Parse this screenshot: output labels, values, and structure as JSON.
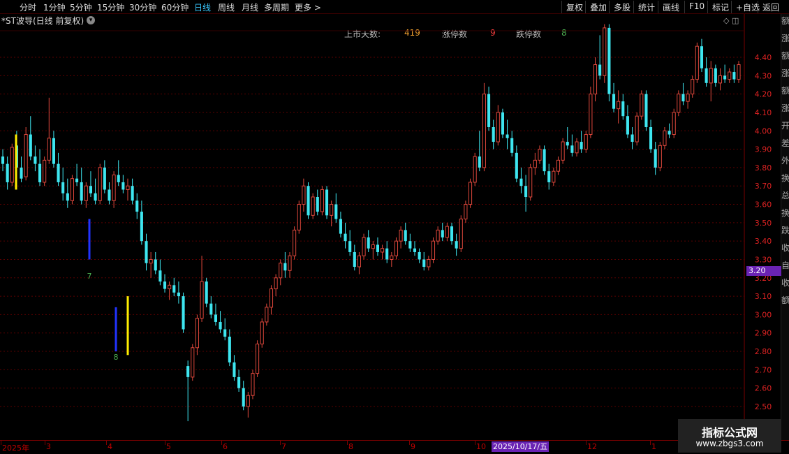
{
  "toolbar": {
    "left_items": [
      "分时",
      "1分钟",
      "5分钟",
      "15分钟",
      "30分钟",
      "60分钟",
      "日线",
      "周线",
      "月线",
      "多周期",
      "更多 >"
    ],
    "active_index": 6,
    "right_items": [
      "复权",
      "叠加",
      "多股",
      "统计",
      "画线",
      "F10",
      "标记",
      "+自选",
      "返回"
    ]
  },
  "stock": {
    "title": "*ST波导(日线 前复权)",
    "dropdown_icon": "chevron-down-icon",
    "corner_icons": "◇ ◫"
  },
  "stats": {
    "listed_days_label": "上市天数:",
    "listed_days_value": "419",
    "limit_up_label": "涨停数",
    "limit_up_value": "9",
    "limit_down_label": "跌停数",
    "limit_down_value": "8"
  },
  "price_axis": {
    "ticks": [
      "4.40",
      "4.30",
      "4.20",
      "4.10",
      "4.00",
      "3.90",
      "3.80",
      "3.70",
      "3.60",
      "3.50",
      "3.40",
      "3.30",
      "3.20",
      "3.10",
      "3.00",
      "2.90",
      "2.80",
      "2.70",
      "2.60",
      "2.50"
    ],
    "current_price": "3.20"
  },
  "markers": [
    {
      "label": "7",
      "color": "#4caf50"
    },
    {
      "label": "8",
      "color": "#4caf50"
    }
  ],
  "date_axis": {
    "labels": [
      "2025年",
      "3",
      "4",
      "5",
      "6",
      "7",
      "8",
      "9",
      "10",
      "12",
      "1"
    ],
    "cursor_date": "2025/10/17/五"
  },
  "right_strip_text": "额涨额涨额涨开差外换总换跌收自收额",
  "watermark": {
    "title": "指标公式网",
    "url": "www.zbgs3.com"
  },
  "colors": {
    "up": "#e0483c",
    "down": "#3ee6f0",
    "grid": "#5a0000",
    "accent_purple": "#6a23b4"
  },
  "chart_data": {
    "type": "candlestick",
    "title": "*ST波导(日线 前复权)",
    "ylim": [
      2.42,
      4.58
    ],
    "x_start_label": "2025年",
    "ohlc": [
      [
        3.86,
        3.9,
        3.78,
        3.82
      ],
      [
        3.82,
        3.86,
        3.68,
        3.72
      ],
      [
        3.72,
        3.93,
        3.7,
        3.91
      ],
      [
        3.92,
        4.0,
        3.78,
        3.8
      ],
      [
        3.8,
        3.86,
        3.72,
        3.74
      ],
      [
        3.75,
        4.02,
        3.73,
        3.98
      ],
      [
        3.98,
        4.08,
        3.84,
        3.86
      ],
      [
        3.86,
        3.92,
        3.78,
        3.82
      ],
      [
        3.82,
        3.9,
        3.7,
        3.72
      ],
      [
        3.72,
        3.86,
        3.7,
        3.84
      ],
      [
        3.84,
        4.18,
        3.82,
        3.96
      ],
      [
        3.96,
        4.0,
        3.8,
        3.82
      ],
      [
        3.82,
        3.88,
        3.7,
        3.72
      ],
      [
        3.72,
        3.8,
        3.62,
        3.66
      ],
      [
        3.66,
        3.74,
        3.58,
        3.62
      ],
      [
        3.62,
        3.76,
        3.6,
        3.74
      ],
      [
        3.74,
        3.82,
        3.7,
        3.72
      ],
      [
        3.72,
        3.8,
        3.6,
        3.62
      ],
      [
        3.62,
        3.72,
        3.58,
        3.7
      ],
      [
        3.7,
        3.78,
        3.64,
        3.66
      ],
      [
        3.66,
        3.74,
        3.6,
        3.62
      ],
      [
        3.62,
        3.82,
        3.6,
        3.8
      ],
      [
        3.8,
        3.84,
        3.66,
        3.68
      ],
      [
        3.68,
        3.72,
        3.6,
        3.62
      ],
      [
        3.62,
        3.78,
        3.58,
        3.76
      ],
      [
        3.76,
        3.84,
        3.7,
        3.72
      ],
      [
        3.72,
        3.76,
        3.66,
        3.68
      ],
      [
        3.68,
        3.74,
        3.62,
        3.7
      ],
      [
        3.7,
        3.74,
        3.6,
        3.62
      ],
      [
        3.62,
        3.66,
        3.52,
        3.56
      ],
      [
        3.56,
        3.62,
        3.38,
        3.4
      ],
      [
        3.4,
        3.44,
        3.24,
        3.28
      ],
      [
        3.28,
        3.34,
        3.2,
        3.3
      ],
      [
        3.3,
        3.34,
        3.22,
        3.24
      ],
      [
        3.24,
        3.3,
        3.16,
        3.18
      ],
      [
        3.18,
        3.22,
        3.12,
        3.14
      ],
      [
        3.14,
        3.18,
        3.08,
        3.16
      ],
      [
        3.16,
        3.2,
        3.1,
        3.12
      ],
      [
        3.12,
        3.18,
        3.06,
        3.1
      ],
      [
        3.1,
        3.12,
        2.9,
        2.92
      ],
      [
        2.72,
        2.75,
        2.42,
        2.66
      ],
      [
        2.66,
        2.84,
        2.64,
        2.82
      ],
      [
        2.82,
        3.0,
        2.78,
        2.98
      ],
      [
        2.98,
        3.32,
        2.96,
        3.18
      ],
      [
        3.18,
        3.2,
        3.04,
        3.06
      ],
      [
        3.06,
        3.1,
        2.98,
        3.0
      ],
      [
        3.0,
        3.06,
        2.94,
        2.96
      ],
      [
        2.96,
        3.02,
        2.9,
        2.92
      ],
      [
        2.92,
        2.98,
        2.86,
        2.88
      ],
      [
        2.88,
        2.92,
        2.72,
        2.74
      ],
      [
        2.74,
        2.78,
        2.64,
        2.66
      ],
      [
        2.66,
        2.7,
        2.58,
        2.6
      ],
      [
        2.6,
        2.64,
        2.48,
        2.5
      ],
      [
        2.5,
        2.58,
        2.44,
        2.56
      ],
      [
        2.56,
        2.7,
        2.54,
        2.68
      ],
      [
        2.68,
        2.86,
        2.66,
        2.84
      ],
      [
        2.84,
        2.98,
        2.82,
        2.96
      ],
      [
        2.96,
        3.06,
        2.94,
        3.04
      ],
      [
        3.04,
        3.16,
        3.0,
        3.14
      ],
      [
        3.14,
        3.22,
        3.1,
        3.2
      ],
      [
        3.2,
        3.3,
        3.16,
        3.28
      ],
      [
        3.28,
        3.34,
        3.2,
        3.24
      ],
      [
        3.24,
        3.34,
        3.2,
        3.32
      ],
      [
        3.32,
        3.48,
        3.3,
        3.46
      ],
      [
        3.46,
        3.62,
        3.44,
        3.6
      ],
      [
        3.6,
        3.74,
        3.56,
        3.7
      ],
      [
        3.7,
        3.72,
        3.52,
        3.54
      ],
      [
        3.54,
        3.66,
        3.52,
        3.64
      ],
      [
        3.64,
        3.68,
        3.54,
        3.56
      ],
      [
        3.56,
        3.7,
        3.54,
        3.68
      ],
      [
        3.68,
        3.7,
        3.52,
        3.54
      ],
      [
        3.54,
        3.62,
        3.48,
        3.6
      ],
      [
        3.6,
        3.66,
        3.5,
        3.52
      ],
      [
        3.52,
        3.56,
        3.42,
        3.44
      ],
      [
        3.44,
        3.5,
        3.36,
        3.4
      ],
      [
        3.4,
        3.46,
        3.32,
        3.34
      ],
      [
        3.34,
        3.38,
        3.24,
        3.26
      ],
      [
        3.26,
        3.34,
        3.22,
        3.32
      ],
      [
        3.32,
        3.44,
        3.3,
        3.42
      ],
      [
        3.42,
        3.46,
        3.34,
        3.36
      ],
      [
        3.36,
        3.4,
        3.3,
        3.38
      ],
      [
        3.38,
        3.42,
        3.32,
        3.34
      ],
      [
        3.34,
        3.38,
        3.3,
        3.36
      ],
      [
        3.36,
        3.4,
        3.28,
        3.3
      ],
      [
        3.3,
        3.34,
        3.26,
        3.32
      ],
      [
        3.32,
        3.42,
        3.3,
        3.4
      ],
      [
        3.4,
        3.48,
        3.36,
        3.46
      ],
      [
        3.46,
        3.5,
        3.38,
        3.4
      ],
      [
        3.4,
        3.44,
        3.34,
        3.36
      ],
      [
        3.36,
        3.4,
        3.32,
        3.34
      ],
      [
        3.34,
        3.36,
        3.28,
        3.3
      ],
      [
        3.3,
        3.34,
        3.24,
        3.26
      ],
      [
        3.26,
        3.32,
        3.24,
        3.3
      ],
      [
        3.3,
        3.42,
        3.28,
        3.4
      ],
      [
        3.4,
        3.48,
        3.38,
        3.46
      ],
      [
        3.46,
        3.5,
        3.4,
        3.42
      ],
      [
        3.42,
        3.5,
        3.4,
        3.48
      ],
      [
        3.48,
        3.5,
        3.38,
        3.4
      ],
      [
        3.4,
        3.44,
        3.32,
        3.36
      ],
      [
        3.36,
        3.54,
        3.34,
        3.52
      ],
      [
        3.52,
        3.62,
        3.5,
        3.6
      ],
      [
        3.6,
        3.74,
        3.58,
        3.72
      ],
      [
        3.72,
        3.88,
        3.7,
        3.86
      ],
      [
        3.86,
        4.0,
        3.78,
        3.8
      ],
      [
        3.8,
        4.26,
        3.78,
        4.2
      ],
      [
        4.2,
        4.24,
        4.0,
        4.02
      ],
      [
        4.02,
        4.06,
        3.9,
        3.94
      ],
      [
        3.94,
        4.14,
        3.92,
        4.1
      ],
      [
        4.1,
        4.12,
        3.96,
        3.98
      ],
      [
        3.98,
        4.06,
        3.9,
        3.96
      ],
      [
        3.96,
        4.0,
        3.86,
        3.88
      ],
      [
        3.88,
        3.92,
        3.72,
        3.74
      ],
      [
        3.74,
        3.8,
        3.66,
        3.7
      ],
      [
        3.7,
        3.76,
        3.56,
        3.64
      ],
      [
        3.64,
        3.82,
        3.62,
        3.8
      ],
      [
        3.8,
        3.88,
        3.76,
        3.84
      ],
      [
        3.84,
        3.92,
        3.82,
        3.9
      ],
      [
        3.9,
        3.92,
        3.76,
        3.78
      ],
      [
        3.78,
        3.82,
        3.68,
        3.72
      ],
      [
        3.72,
        3.8,
        3.7,
        3.78
      ],
      [
        3.78,
        3.86,
        3.76,
        3.84
      ],
      [
        3.84,
        3.96,
        3.82,
        3.94
      ],
      [
        3.94,
        4.02,
        3.9,
        3.92
      ],
      [
        3.92,
        3.98,
        3.86,
        3.88
      ],
      [
        3.88,
        3.96,
        3.86,
        3.94
      ],
      [
        3.94,
        4.0,
        3.88,
        3.9
      ],
      [
        3.9,
        4.0,
        3.88,
        3.98
      ],
      [
        3.98,
        4.24,
        3.96,
        4.2
      ],
      [
        4.2,
        4.4,
        4.16,
        4.36
      ],
      [
        4.36,
        4.52,
        4.28,
        4.3
      ],
      [
        4.3,
        4.58,
        4.26,
        4.56
      ],
      [
        4.56,
        4.58,
        4.16,
        4.2
      ],
      [
        4.2,
        4.26,
        4.1,
        4.12
      ],
      [
        4.12,
        4.22,
        4.04,
        4.16
      ],
      [
        4.16,
        4.2,
        4.06,
        4.08
      ],
      [
        4.08,
        4.14,
        3.96,
        3.98
      ],
      [
        3.98,
        4.02,
        3.9,
        3.94
      ],
      [
        3.94,
        4.1,
        3.92,
        4.08
      ],
      [
        4.08,
        4.22,
        4.06,
        4.2
      ],
      [
        4.2,
        4.22,
        4.0,
        4.02
      ],
      [
        4.02,
        4.06,
        3.88,
        3.9
      ],
      [
        3.9,
        3.94,
        3.76,
        3.8
      ],
      [
        3.8,
        3.94,
        3.78,
        3.92
      ],
      [
        3.92,
        4.02,
        3.9,
        4.0
      ],
      [
        4.0,
        4.04,
        3.96,
        3.98
      ],
      [
        3.98,
        4.12,
        3.96,
        4.1
      ],
      [
        4.1,
        4.22,
        4.08,
        4.2
      ],
      [
        4.2,
        4.26,
        4.14,
        4.16
      ],
      [
        4.16,
        4.22,
        4.12,
        4.2
      ],
      [
        4.2,
        4.3,
        4.18,
        4.28
      ],
      [
        4.28,
        4.48,
        4.26,
        4.46
      ],
      [
        4.46,
        4.5,
        4.32,
        4.34
      ],
      [
        4.34,
        4.4,
        4.24,
        4.26
      ],
      [
        4.26,
        4.38,
        4.16,
        4.34
      ],
      [
        4.34,
        4.36,
        4.24,
        4.26
      ],
      [
        4.26,
        4.34,
        4.22,
        4.3
      ],
      [
        4.3,
        4.36,
        4.26,
        4.28
      ],
      [
        4.28,
        4.34,
        4.26,
        4.32
      ],
      [
        4.32,
        4.36,
        4.26,
        4.28
      ],
      [
        4.28,
        4.38,
        4.26,
        4.36
      ]
    ]
  }
}
